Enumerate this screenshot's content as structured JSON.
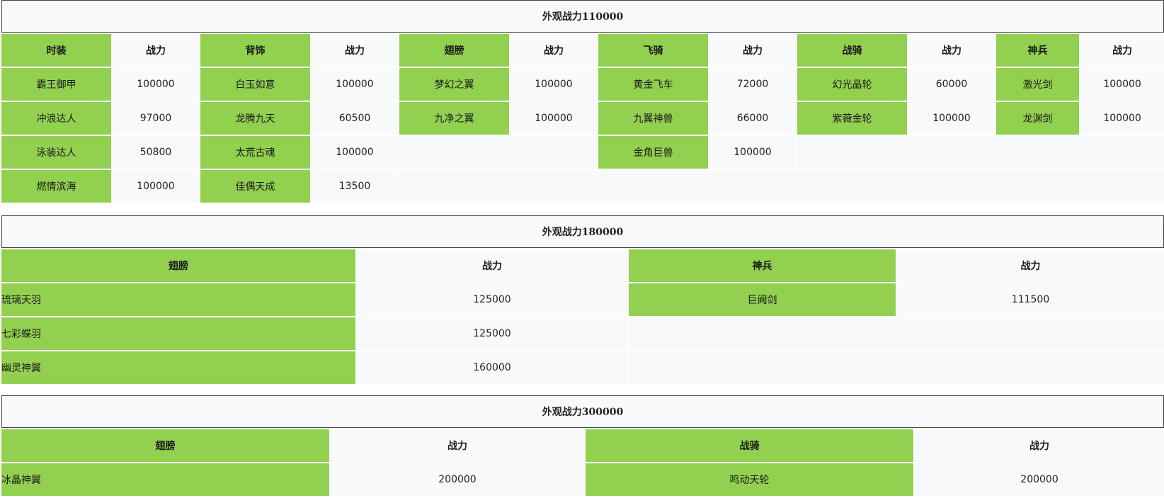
{
  "section1": {
    "title": "外观战力110000",
    "cat1": "时装",
    "cat2": "背饰",
    "cat3": "翅膀",
    "cat4": "飞骑",
    "cat5": "战骑",
    "cat6": "神兵",
    "power_label": "战力",
    "rows": [
      {
        "c1n": "霸王御甲",
        "c1v": "100000",
        "c2n": "白玉如意",
        "c2v": "100000",
        "c3n": "梦幻之翼",
        "c3v": "100000",
        "c4n": "黄金飞车",
        "c4v": "72000",
        "c5n": "幻光晶轮",
        "c5v": "60000",
        "c6n": "激光剑",
        "c6v": "100000"
      },
      {
        "c1n": "冲浪达人",
        "c1v": "97000",
        "c2n": "龙腾九天",
        "c2v": "60500",
        "c3n": "九净之翼",
        "c3v": "100000",
        "c4n": "九翼神兽",
        "c4v": "66000",
        "c5n": "紫薇金轮",
        "c5v": "100000",
        "c6n": "龙渊剑",
        "c6v": "100000"
      },
      {
        "c1n": "泳装达人",
        "c1v": "50800",
        "c2n": "太荒古魂",
        "c2v": "100000",
        "c4n": "金角巨兽",
        "c4v": "100000"
      },
      {
        "c1n": "燃情滨海",
        "c1v": "100000",
        "c2n": "佳偶天成",
        "c2v": "13500"
      }
    ]
  },
  "section2": {
    "title": "外观战力180000",
    "cat1": "翅膀",
    "cat2": "神兵",
    "power_label": "战力",
    "rows": [
      {
        "c1n": "琉璃天羽",
        "c1v": "125000",
        "c2n": "巨阙剑",
        "c2v": "111500"
      },
      {
        "c1n": "七彩蝶羽",
        "c1v": "125000"
      },
      {
        "c1n": "幽灵神翼",
        "c1v": "160000"
      }
    ]
  },
  "section3": {
    "title": "外观战力300000",
    "cat1": "翅膀",
    "cat2": "战骑",
    "power_label": "战力",
    "rows": [
      {
        "c1n": "冰晶神翼",
        "c1v": "200000",
        "c2n": "鸣动天轮",
        "c2v": "200000"
      }
    ]
  },
  "colors": {
    "green": "#92d050",
    "light": "#f8f9fa",
    "border": "#444444"
  }
}
